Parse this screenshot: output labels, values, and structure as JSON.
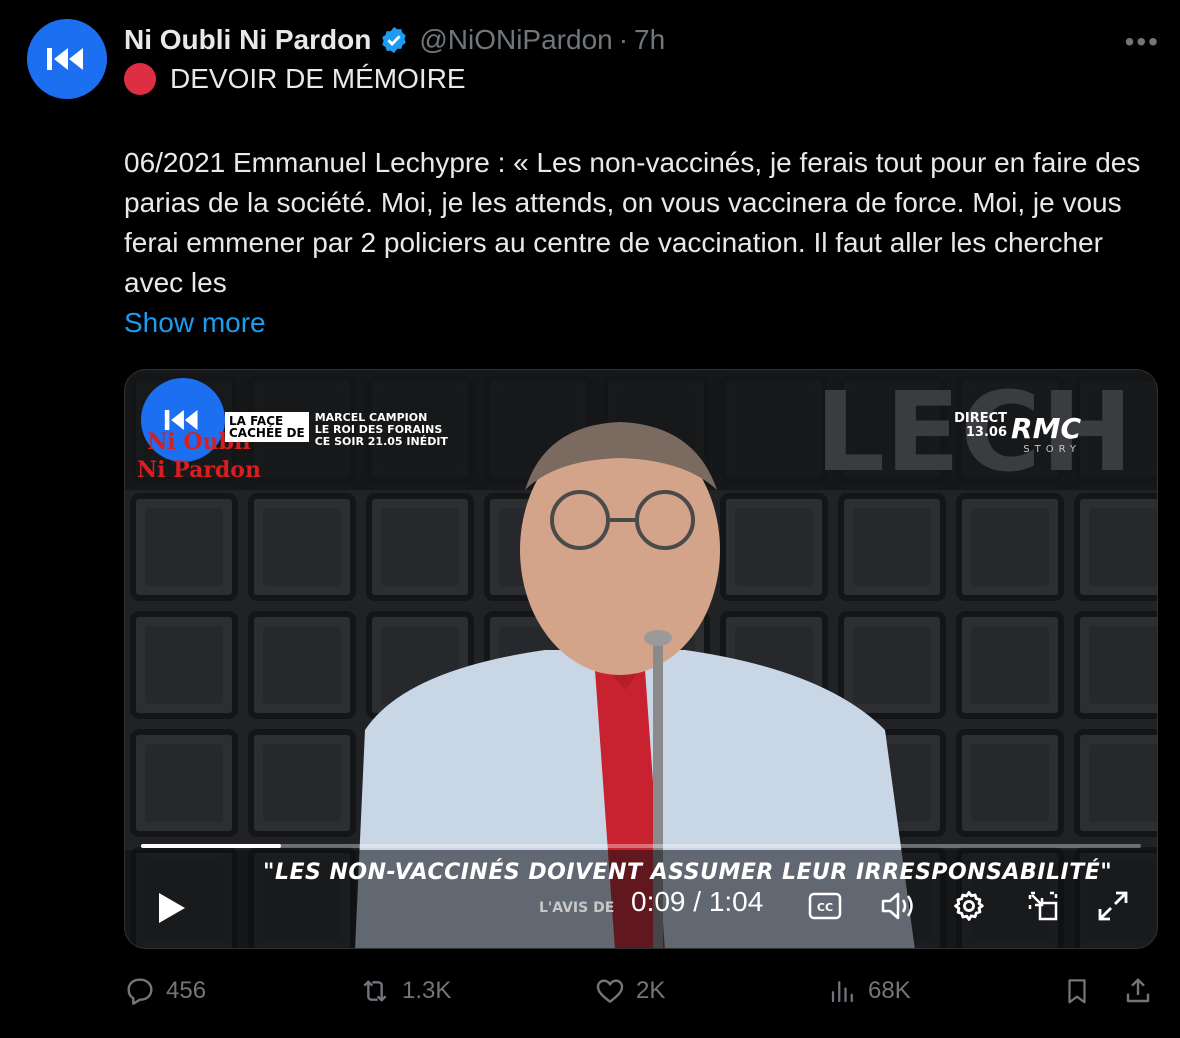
{
  "tweet": {
    "author_name": "Ni Oubli Ni Pardon",
    "handle": "@NiONiPardon",
    "separator": "·",
    "time": "7h",
    "more_label": "•••",
    "subject": "DEVOIR DE MÉMOIRE",
    "body": "06/2021 Emmanuel Lechypre : « Les non-vaccinés, je ferais tout pour en faire des parias de la société. Moi, je les attends, on vous vaccinera de force. Moi, je vous ferai emmener par 2 policiers au centre de vaccination. Il faut aller les chercher avec les",
    "show_more": "Show more"
  },
  "video": {
    "watermark_line1": "Ni Oubli",
    "watermark_line2": "Ni Pardon",
    "promo_badge_line1": "LA FACE",
    "promo_badge_line2": "CACHÉE DE",
    "promo_line1": "MARCEL CAMPION",
    "promo_line2": "LE ROI DES FORAINS",
    "promo_line3": "CE SOIR 21.05 INÉDIT",
    "direct_label": "DIRECT",
    "direct_date": "13.06",
    "channel": "RMC",
    "channel_sub": "STORY",
    "lower_third": "\"LES NON-VACCINÉS DOIVENT ASSUMER LEUR IRRESPONSABILITÉ\"",
    "lower_sub": "L'AVIS DE",
    "timecode": "0:09 / 1:04",
    "progress": 0.14
  },
  "actions": {
    "replies": "456",
    "reposts": "1.3K",
    "likes": "2K",
    "views": "68K"
  },
  "colors": {
    "accent": "#1d9bf0",
    "avatar_blue": "#1d6ff2",
    "muted": "#71767b",
    "red_dot": "#dd2e44"
  }
}
